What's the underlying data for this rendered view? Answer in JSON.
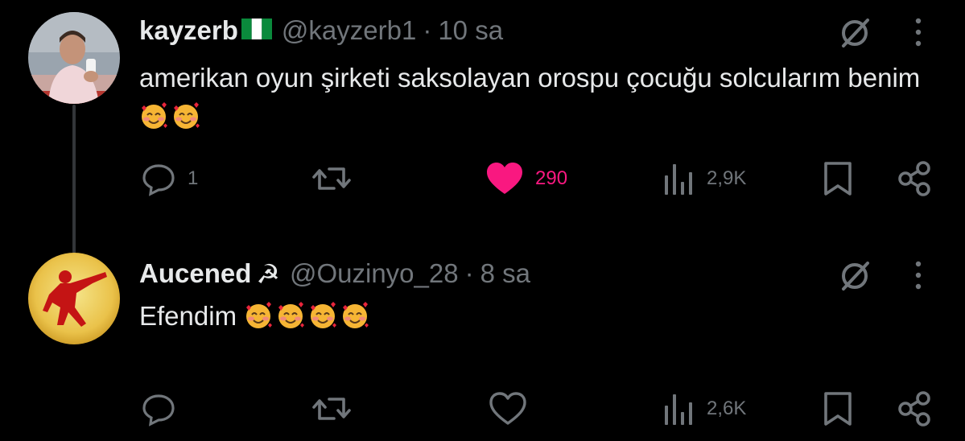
{
  "tweets": [
    {
      "name": "kayzerb",
      "handle": "@kayzerb1",
      "separator": "·",
      "time": "10 sa",
      "text": "amerikan oyun şirketi saksolayan orospu çocuğu solcularım benim",
      "emojis": [
        "smiling-face-with-hearts",
        "smiling-face-with-hearts"
      ],
      "flag": "nigeria-flag",
      "stats": {
        "replies": "1",
        "likes": "290",
        "views": "2,9K"
      },
      "liked": true
    },
    {
      "name": "Aucened",
      "badge": "☭",
      "handle": "@Ouzinyo_28",
      "separator": "·",
      "time": "8 sa",
      "text": "Efendim",
      "emojis": [
        "smiling-face-with-hearts",
        "smiling-face-with-hearts",
        "smiling-face-with-hearts",
        "smiling-face-with-hearts"
      ],
      "stats": {
        "replies": "",
        "likes": "",
        "views": "2,6K"
      },
      "liked": false
    }
  ],
  "colors": {
    "background": "#000000",
    "text": "#e7e9ea",
    "muted": "#71767b",
    "like": "#f91880",
    "thread_line": "#333639"
  }
}
